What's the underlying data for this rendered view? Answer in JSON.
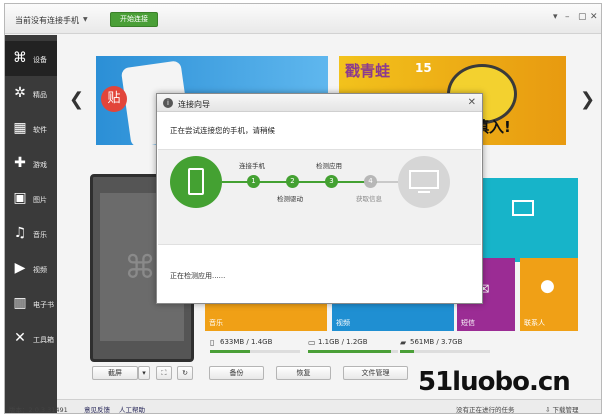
{
  "titlebar": {
    "connection_status": "当前没有连接手机",
    "connect_button": "开始连接"
  },
  "sidebar": {
    "items": [
      {
        "label": "设备",
        "icon": "device-icon",
        "glyph": "⌘"
      },
      {
        "label": "精品",
        "icon": "gear-icon",
        "glyph": "✲"
      },
      {
        "label": "软件",
        "icon": "apps-grid-icon",
        "glyph": "▦"
      },
      {
        "label": "游戏",
        "icon": "gamepad-icon",
        "glyph": "✚"
      },
      {
        "label": "图片",
        "icon": "picture-icon",
        "glyph": "▣"
      },
      {
        "label": "音乐",
        "icon": "music-icon",
        "glyph": "♫"
      },
      {
        "label": "视频",
        "icon": "video-icon",
        "glyph": "▶"
      },
      {
        "label": "电子书",
        "icon": "book-icon",
        "glyph": "▥"
      },
      {
        "label": "工具箱",
        "icon": "tools-icon",
        "glyph": "✕"
      }
    ]
  },
  "banner": {
    "left_badge": "贴",
    "right_text": "症慎入!",
    "right_top": "戳青蛙",
    "right_num": "15"
  },
  "tiles": {
    "music": "音乐",
    "video": "视频",
    "sms": "短信",
    "contacts": "联系人"
  },
  "storage": [
    {
      "label": "633MB / 1.4GB",
      "fill": 0.44
    },
    {
      "label": "1.1GB / 1.2GB",
      "fill": 0.92
    },
    {
      "label": "561MB / 3.7GB",
      "fill": 0.15
    }
  ],
  "actions": {
    "screenshot": "截屏",
    "backup": "备份",
    "restore": "恢复",
    "file_manager": "文件管理"
  },
  "statusbar": {
    "version": "版本：2.0.3.31491",
    "feedback": "意见反馈",
    "help": "人工帮助",
    "tasks": "没有正在进行的任务",
    "download": "下载管理"
  },
  "dialog": {
    "title": "连接向导",
    "message": "正在尝试连接您的手机，请稍候",
    "steps": [
      {
        "num": "1",
        "label": "连接手机"
      },
      {
        "num": "2",
        "label": "检测驱动"
      },
      {
        "num": "3",
        "label": "检测应用"
      },
      {
        "num": "4",
        "label": "获取信息"
      }
    ],
    "status": "正在检测应用......"
  },
  "watermark": "51luobo.cn",
  "colors": {
    "accent_green": "#4a9f37",
    "orange": "#f0a016",
    "blue": "#1f8fd2",
    "purple": "#9b2c94",
    "cyan": "#17b4c9"
  }
}
